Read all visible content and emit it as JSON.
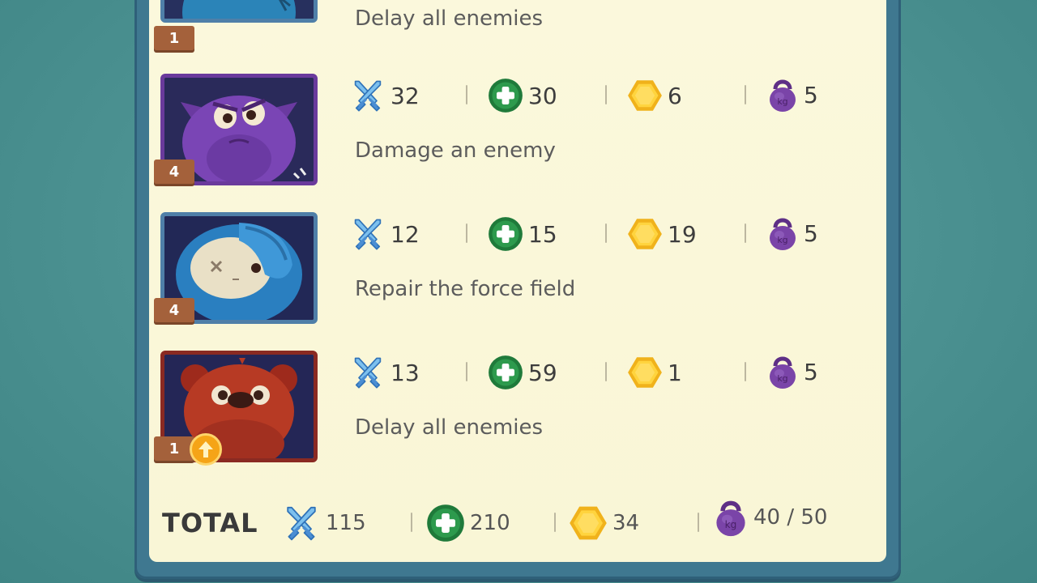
{
  "rows": [
    {
      "level": "1",
      "desc": "Delay all enemies"
    },
    {
      "level": "4",
      "attack": "32",
      "health": "30",
      "gold": "6",
      "weight": "5",
      "desc": "Damage an enemy"
    },
    {
      "level": "4",
      "attack": "12",
      "health": "15",
      "gold": "19",
      "weight": "5",
      "desc": "Repair the force field"
    },
    {
      "level": "1",
      "attack": "13",
      "health": "59",
      "gold": "1",
      "weight": "5",
      "desc": "Delay all enemies",
      "upgrade_available": true
    }
  ],
  "total": {
    "label": "TOTAL",
    "attack": "115",
    "health": "210",
    "gold": "34",
    "weight": "40 / 50"
  },
  "icons": {
    "attack": "crossed-swords-icon",
    "health": "health-cross-icon",
    "gold": "gold-hexagon-icon",
    "weight": "kettlebell-icon",
    "upgrade": "upgrade-arrow-icon"
  },
  "colors": {
    "panel": "#fbf8dc",
    "frame": "#3f7890",
    "level_badge": "#a4613b",
    "upgrade": "#f5a417"
  }
}
